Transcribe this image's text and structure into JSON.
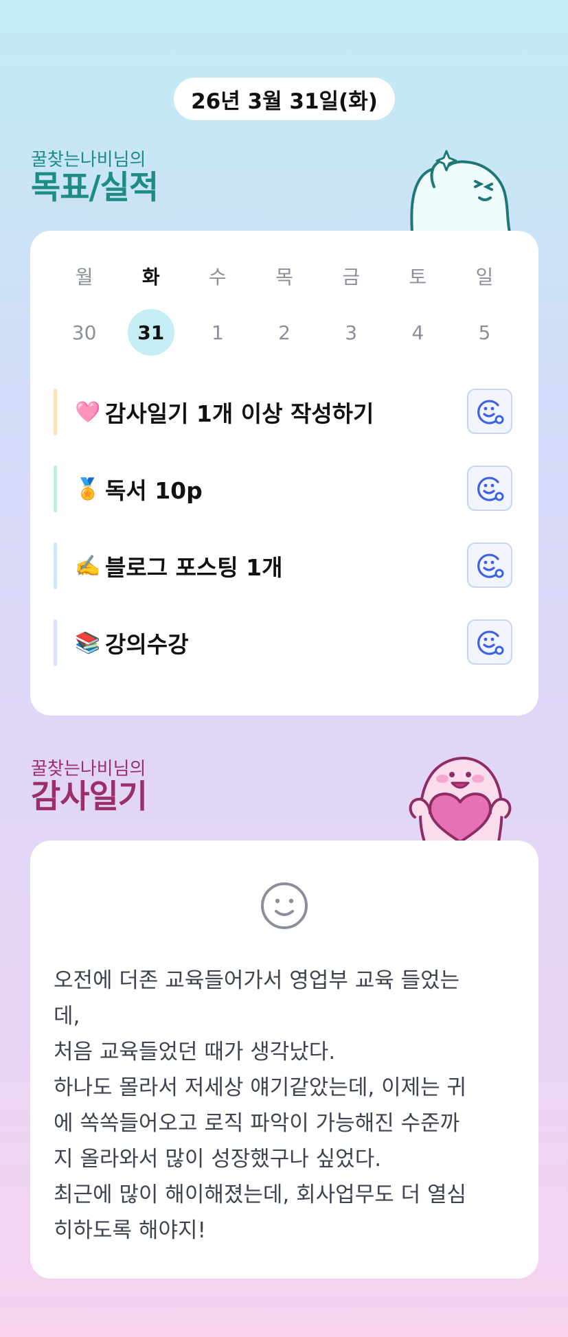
{
  "header": {
    "date": "26년 3월 31일(화)"
  },
  "goals_section": {
    "owner": "꿀찾는나비님의",
    "title": "목표/실적",
    "week": {
      "weekdays": [
        "월",
        "화",
        "수",
        "목",
        "금",
        "토",
        "일"
      ],
      "days": [
        "30",
        "31",
        "1",
        "2",
        "3",
        "4",
        "5"
      ],
      "selected_index": 1
    },
    "goals": [
      {
        "emoji": "🩷",
        "label": "감사일기 1개 이상 작성하기",
        "bar_color": "#fde2b8"
      },
      {
        "emoji": "🏅",
        "label": "독서 10p",
        "bar_color": "#bfeed8"
      },
      {
        "emoji": "✍️",
        "label": "블로그 포스팅 1개",
        "bar_color": "#c8eaf7"
      },
      {
        "emoji": "📚",
        "label": "강의수강",
        "bar_color": "#d9e2fb"
      }
    ],
    "goal_button_icon": "smile-add-icon"
  },
  "thanks_section": {
    "owner": "꿀찾는나비님의",
    "title": "감사일기",
    "mood_icon": "smile-icon",
    "text": "오전에 더존 교육들어가서 영업부 교육 들었는\n데,\n처음 교육들었던 때가 생각났다.\n하나도 몰라서 저세상 얘기같았는데, 이제는 귀\n에 쏙쏙들어오고 로직 파악이 가능해진 수준까\n지 올라와서 많이 성장했구나 싶었다.\n최근에 많이 해이해졌는데, 회사업무도 더 열심\n히하도록 해야지!"
  },
  "colors": {
    "goal_accent": "#1d8b86",
    "thanks_accent": "#9b2f6a",
    "selected_day_bg": "#c4eef4",
    "icon_blue": "#3b62e8"
  }
}
